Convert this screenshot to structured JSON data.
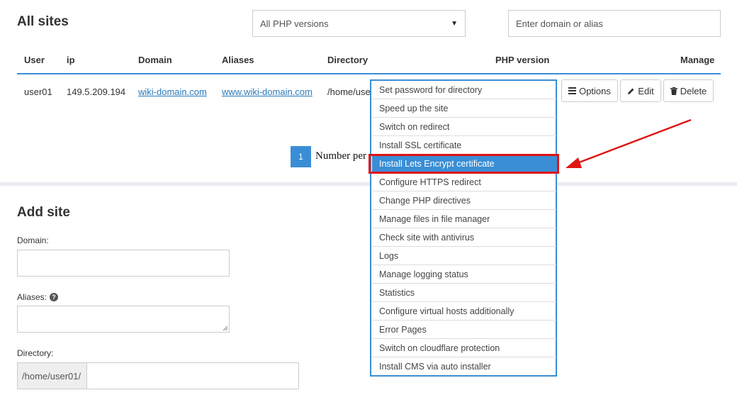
{
  "header": {
    "title": "All sites",
    "php_filter": "All PHP versions",
    "search_placeholder": "Enter domain or alias"
  },
  "table": {
    "columns": [
      "User",
      "ip",
      "Domain",
      "Aliases",
      "Directory",
      "PHP version",
      "Manage"
    ],
    "rows": [
      {
        "user": "user01",
        "ip": "149.5.209.194",
        "domain": "wiki-domain.com",
        "aliases": "www.wiki-domain.com",
        "directory": "/home/use"
      }
    ],
    "actions": {
      "options": "Options",
      "edit": "Edit",
      "delete": "Delete"
    }
  },
  "pagination": {
    "current_page": "1",
    "per_page_label": "Number per"
  },
  "options_menu": {
    "items": [
      "Set password for directory",
      "Speed up the site",
      "Switch on redirect",
      "Install SSL certificate",
      "Install Lets Encrypt certificate",
      "Configure HTTPS redirect",
      "Change PHP directives",
      "Manage files in file manager",
      "Check site with antivirus",
      "Logs",
      "Manage logging status",
      "Statistics",
      "Configure virtual hosts additionally",
      "Error Pages",
      "Switch on cloudflare protection",
      "Install CMS via auto installer"
    ],
    "highlighted_item": "Install Lets Encrypt certificate"
  },
  "add_site": {
    "title": "Add site",
    "domain_label": "Domain:",
    "aliases_label": "Aliases:",
    "directory_label": "Directory:",
    "directory_prefix": "/home/user01/"
  },
  "colors": {
    "accent": "#3a8ed6",
    "link": "#2a7ab7",
    "annotation": "#e01414"
  }
}
